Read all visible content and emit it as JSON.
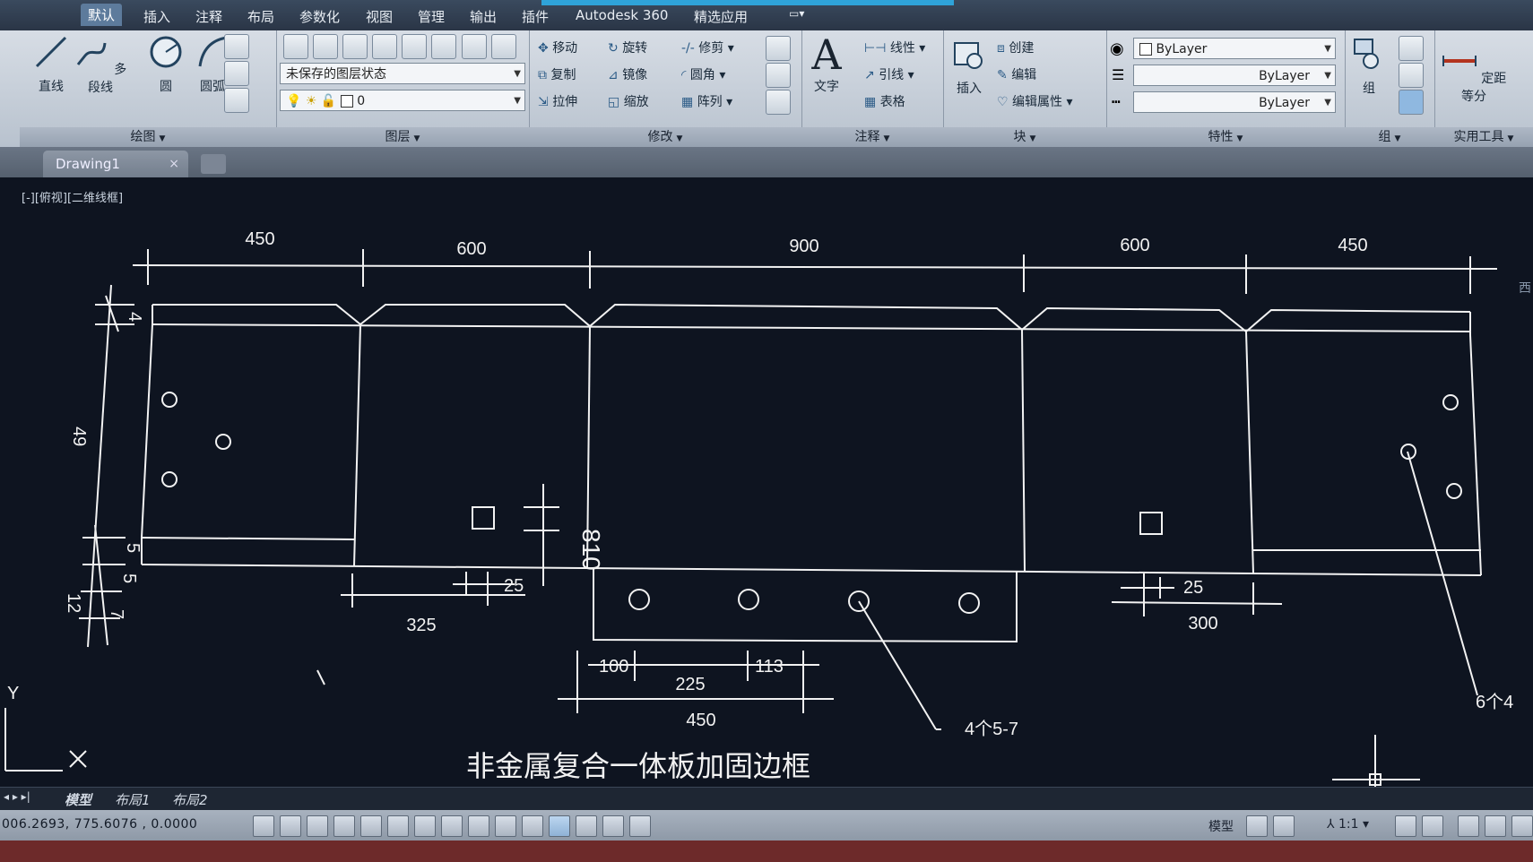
{
  "menu": {
    "tabs": [
      "默认",
      "插入",
      "注释",
      "布局",
      "参数化",
      "视图",
      "管理",
      "输出",
      "插件",
      "Autodesk 360",
      "精选应用"
    ],
    "active_tab": "默认"
  },
  "ribbon": {
    "draw": {
      "title": "绘图",
      "line": "直线",
      "polyline": "多段线",
      "circle": "圆",
      "arc": "圆弧"
    },
    "layers": {
      "title": "图层",
      "state": "未保存的图层状态",
      "current_layer": "0"
    },
    "modify": {
      "title": "修改",
      "move": "移动",
      "rotate": "旋转",
      "trim": "修剪",
      "copy": "复制",
      "mirror": "镜像",
      "fillet": "圆角",
      "stretch": "拉伸",
      "scale": "缩放",
      "array": "阵列"
    },
    "annotation": {
      "title": "注释",
      "text": "文字",
      "linear": "线性",
      "leader": "引线",
      "table": "表格"
    },
    "block": {
      "title": "块",
      "insert": "插入",
      "create": "创建",
      "edit": "编辑",
      "edit_attr": "编辑属性"
    },
    "properties": {
      "title": "特性",
      "color": "ByLayer",
      "linetype": "ByLayer",
      "lineweight": "ByLayer"
    },
    "groups": {
      "title": "组",
      "group": "组"
    },
    "utilities": {
      "title": "实用工具",
      "measure": "定距等分"
    }
  },
  "document": {
    "tab_name": "Drawing1",
    "close": "×"
  },
  "viewport": {
    "label": "[-][俯视][二维线框]"
  },
  "drawing": {
    "top_dims": [
      "450",
      "600",
      "900",
      "600",
      "450"
    ],
    "left_dims": [
      "4",
      "49",
      "5",
      "5",
      "12",
      "7"
    ],
    "small_dims": {
      "a": "25",
      "b": "325",
      "c": "810",
      "d": "25",
      "e": "300",
      "f": "100",
      "g": "225",
      "h": "113",
      "i": "450"
    },
    "callouts": {
      "holes_bottom": "4个5-7",
      "holes_right": "6个4"
    },
    "title": "非金属复合一体板加固边框",
    "axis_y": "Y",
    "side_mark": "西"
  },
  "layouts": {
    "model": "模型",
    "layout1": "布局1",
    "layout2": "布局2"
  },
  "status": {
    "coords": "006.2693, 775.6076 , 0.0000",
    "model_btn": "模型",
    "scale": "1:1"
  },
  "colors": {
    "canvas_bg": "#0e1420",
    "line": "#ffffff",
    "ribbon": "#c9d1db"
  }
}
